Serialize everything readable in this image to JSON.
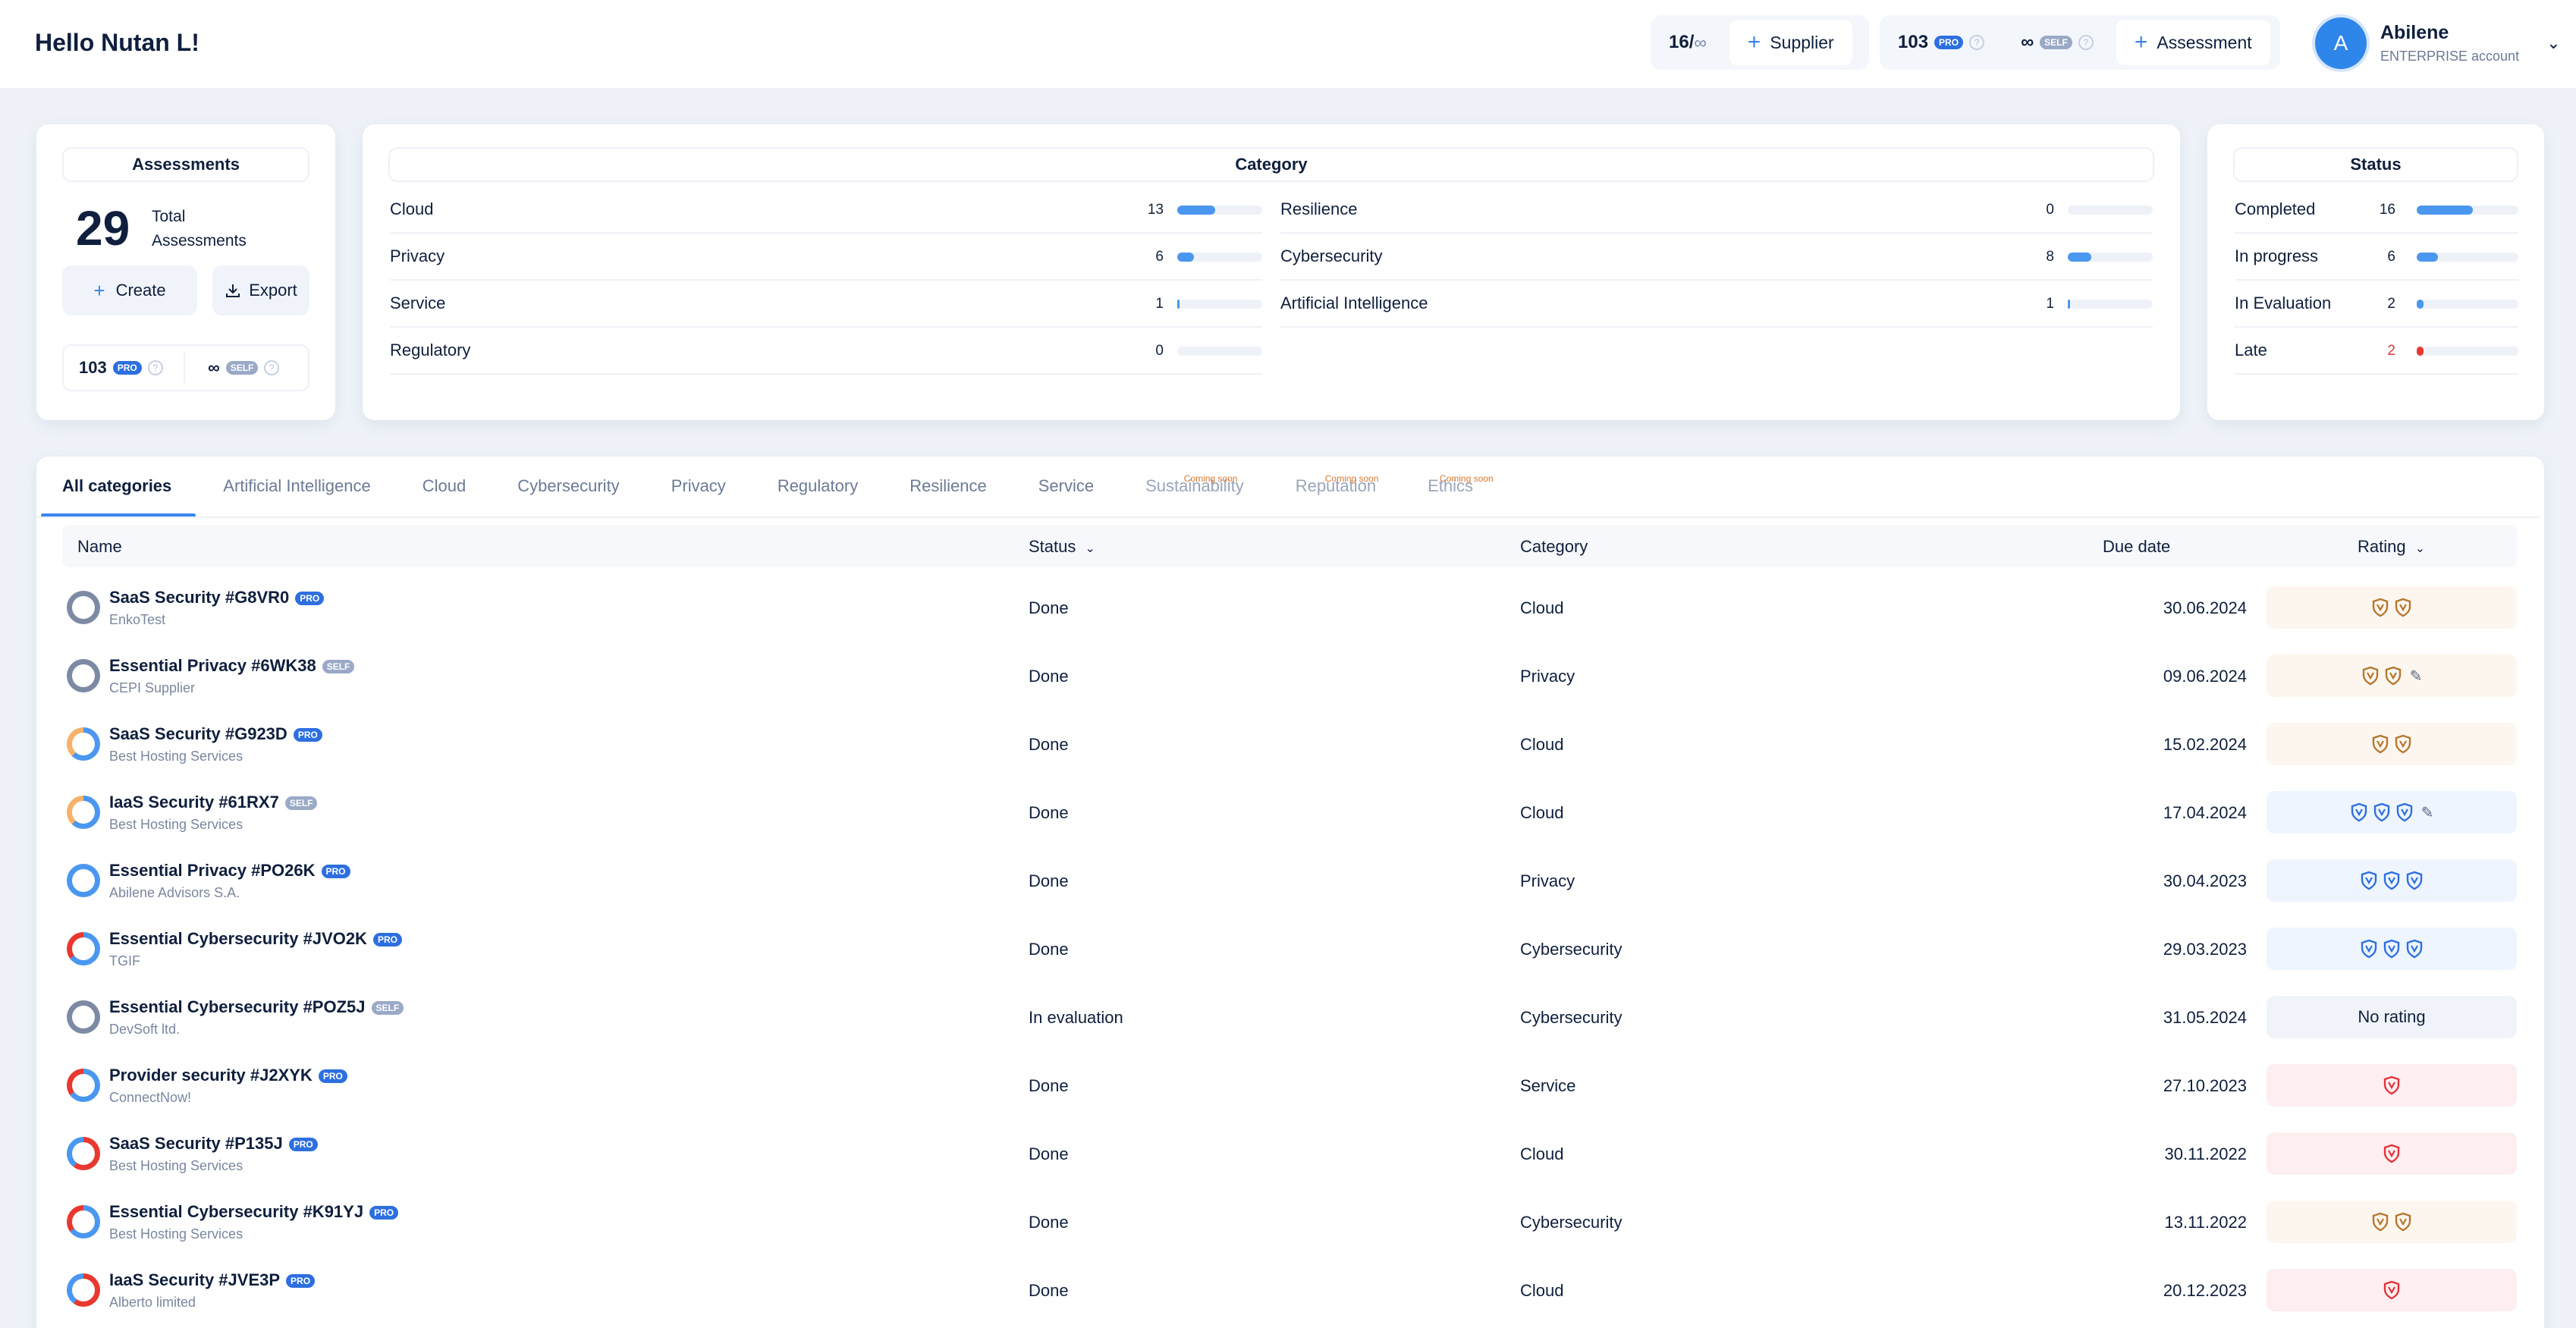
{
  "header": {
    "greeting": "Hello Nutan L!",
    "supplier_count": "16/",
    "supplier_infinity": "∞",
    "supplier_button": "Supplier",
    "pro_credits": "103",
    "pro_badge": "PRO",
    "self_credits": "∞",
    "self_badge": "SELF",
    "assessment_button": "Assessment",
    "qmark": "?",
    "plus": "+"
  },
  "user": {
    "initial": "A",
    "name": "Abilene",
    "account": "ENTERPRISE account",
    "chevron": "⌄"
  },
  "assessments_card": {
    "title": "Assessments",
    "total": "29",
    "total_label_1": "Total",
    "total_label_2": "Assessments",
    "create": "Create",
    "export": "Export",
    "pro_credits": "103",
    "pro_badge": "PRO",
    "self_credits": "∞",
    "self_badge": "SELF"
  },
  "category_card": {
    "title": "Category",
    "left": [
      {
        "label": "Cloud",
        "count": "13",
        "fraction": 0.45
      },
      {
        "label": "Privacy",
        "count": "6",
        "fraction": 0.2
      },
      {
        "label": "Service",
        "count": "1",
        "fraction": 0.03
      },
      {
        "label": "Regulatory",
        "count": "0",
        "fraction": 0
      }
    ],
    "right": [
      {
        "label": "Resilience",
        "count": "0",
        "fraction": 0
      },
      {
        "label": "Cybersecurity",
        "count": "8",
        "fraction": 0.28
      },
      {
        "label": "Artificial Intelligence",
        "count": "1",
        "fraction": 0.03
      }
    ]
  },
  "status_card": {
    "title": "Status",
    "rows": [
      {
        "label": "Completed",
        "count": "16",
        "fraction": 0.55,
        "late": false
      },
      {
        "label": "In progress",
        "count": "6",
        "fraction": 0.21,
        "late": false
      },
      {
        "label": "In Evaluation",
        "count": "2",
        "fraction": 0.07,
        "late": false
      },
      {
        "label": "Late",
        "count": "2",
        "fraction": 0.07,
        "late": true
      }
    ]
  },
  "tabs": [
    {
      "label": "All categories",
      "state": "active",
      "soon": ""
    },
    {
      "label": "Artificial Intelligence",
      "state": "normal",
      "soon": ""
    },
    {
      "label": "Cloud",
      "state": "normal",
      "soon": ""
    },
    {
      "label": "Cybersecurity",
      "state": "normal",
      "soon": ""
    },
    {
      "label": "Privacy",
      "state": "normal",
      "soon": ""
    },
    {
      "label": "Regulatory",
      "state": "normal",
      "soon": ""
    },
    {
      "label": "Resilience",
      "state": "normal",
      "soon": ""
    },
    {
      "label": "Service",
      "state": "normal",
      "soon": ""
    },
    {
      "label": "Sustainability",
      "state": "disabled",
      "soon": "Coming soon"
    },
    {
      "label": "Reputation",
      "state": "disabled",
      "soon": "Coming soon"
    },
    {
      "label": "Ethics",
      "state": "disabled",
      "soon": "Coming soon"
    }
  ],
  "table": {
    "headers": {
      "name": "Name",
      "status": "Status",
      "category": "Category",
      "due": "Due date",
      "rating": "Rating"
    },
    "rows": [
      {
        "name": "SaaS Security #G8VR0",
        "badge": "PRO",
        "supplier": "EnkoTest",
        "status": "Done",
        "category": "Cloud",
        "due": "30.06.2024",
        "rating": "bronze",
        "shields": 2,
        "pencil": false,
        "ring": "grey"
      },
      {
        "name": "Essential Privacy #6WK38",
        "badge": "SELF",
        "supplier": "CEPI Supplier",
        "status": "Done",
        "category": "Privacy",
        "due": "09.06.2024",
        "rating": "bronze",
        "shields": 2,
        "pencil": true,
        "ring": "grey"
      },
      {
        "name": "SaaS Security #G923D",
        "badge": "PRO",
        "supplier": "Best Hosting Services",
        "status": "Done",
        "category": "Cloud",
        "due": "15.02.2024",
        "rating": "bronze",
        "shields": 2,
        "pencil": false,
        "ring": "blue-orange"
      },
      {
        "name": "IaaS Security #61RX7",
        "badge": "SELF",
        "supplier": "Best Hosting Services",
        "status": "Done",
        "category": "Cloud",
        "due": "17.04.2024",
        "rating": "blue",
        "shields": 3,
        "pencil": true,
        "ring": "blue-orange"
      },
      {
        "name": "Essential Privacy #PO26K",
        "badge": "PRO",
        "supplier": "Abilene Advisors S.A.",
        "status": "Done",
        "category": "Privacy",
        "due": "30.04.2023",
        "rating": "blue",
        "shields": 3,
        "pencil": false,
        "ring": "blue"
      },
      {
        "name": "Essential Cybersecurity #JVO2K",
        "badge": "PRO",
        "supplier": "TGIF",
        "status": "Done",
        "category": "Cybersecurity",
        "due": "29.03.2023",
        "rating": "blue",
        "shields": 3,
        "pencil": false,
        "ring": "blue-red"
      },
      {
        "name": "Essential Cybersecurity #POZ5J",
        "badge": "SELF",
        "supplier": "DevSoft ltd.",
        "status": "In evaluation",
        "category": "Cybersecurity",
        "due": "31.05.2024",
        "rating": "none",
        "shields": 0,
        "pencil": false,
        "ring": "grey",
        "rating_text": "No rating"
      },
      {
        "name": "Provider security #J2XYK",
        "badge": "PRO",
        "supplier": "ConnectNow!",
        "status": "Done",
        "category": "Service",
        "due": "27.10.2023",
        "rating": "red",
        "shields": 1,
        "pencil": false,
        "ring": "blue-red"
      },
      {
        "name": "SaaS Security #P135J",
        "badge": "PRO",
        "supplier": "Best Hosting Services",
        "status": "Done",
        "category": "Cloud",
        "due": "30.11.2022",
        "rating": "red",
        "shields": 1,
        "pencil": false,
        "ring": "red-blue"
      },
      {
        "name": "Essential Cybersecurity #K91YJ",
        "badge": "PRO",
        "supplier": "Best Hosting Services",
        "status": "Done",
        "category": "Cybersecurity",
        "due": "13.11.2022",
        "rating": "bronze",
        "shields": 2,
        "pencil": false,
        "ring": "blue-red"
      },
      {
        "name": "IaaS Security #JVE3P",
        "badge": "PRO",
        "supplier": "Alberto limited",
        "status": "Done",
        "category": "Cloud",
        "due": "20.12.2023",
        "rating": "red",
        "shields": 1,
        "pencil": false,
        "ring": "red-blue"
      }
    ]
  },
  "colors": {
    "accent": "#3a86ee",
    "bronze": "#b5772e",
    "blue": "#2d6fe0",
    "red": "#e0343a"
  }
}
